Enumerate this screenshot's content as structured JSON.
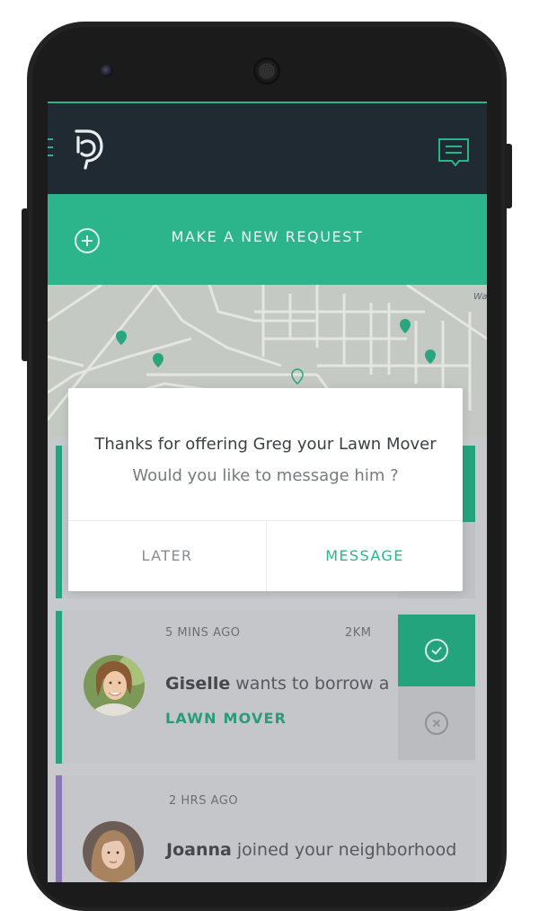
{
  "header": {
    "logo_letter": "D",
    "menu_icon": "menu-icon",
    "chat_icon": "chat-icon"
  },
  "request_bar": {
    "label": "MAKE A NEW REQUEST",
    "icon": "plus-circle-icon"
  },
  "map": {
    "label": "Wa"
  },
  "dialog": {
    "title": "Thanks for offering Greg your Lawn Mover",
    "subtitle": "Would you like to message him ?",
    "later_label": "LATER",
    "message_label": "MESSAGE"
  },
  "feed": [
    {
      "time": "5 MINS AGO",
      "distance": "2KM",
      "name": "Giselle",
      "text": "wants to borrow a",
      "item": "LAWN MOVER"
    },
    {
      "time": "2 HRS AGO",
      "name": "Joanna",
      "text": "joined your neighborhood"
    }
  ],
  "colors": {
    "accent": "#2cb48a",
    "appbar": "#1f2a32",
    "purple_accent": "#8b76b5"
  }
}
